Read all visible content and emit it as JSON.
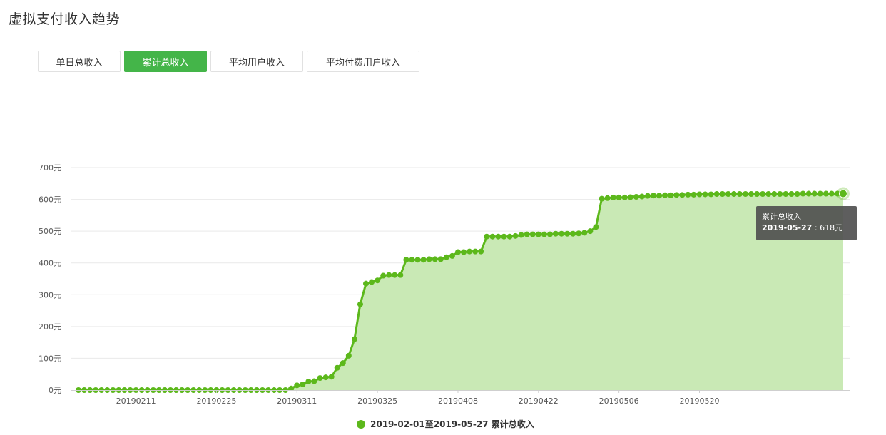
{
  "page": {
    "title": "虚拟支付收入趋势"
  },
  "tabs": [
    {
      "label": "单日总收入",
      "active": false
    },
    {
      "label": "累计总收入",
      "active": true
    },
    {
      "label": "平均用户收入",
      "active": false
    },
    {
      "label": "平均付费用户收入",
      "active": false
    }
  ],
  "tooltip": {
    "series": "累计总收入",
    "date": "2019-05-27",
    "value": "618元"
  },
  "legend": {
    "label": "2019-02-01至2019-05-27 累计总收入"
  },
  "colors": {
    "accent": "#44b549",
    "line": "#5cb81b",
    "area": "#c9e9b5"
  },
  "chart_data": {
    "type": "area",
    "ylim": [
      0,
      700
    ],
    "yticks": [
      "0元",
      "100元",
      "200元",
      "300元",
      "400元",
      "500元",
      "600元",
      "700元"
    ],
    "xticks": [
      "20190211",
      "20190225",
      "20190311",
      "20190325",
      "20190408",
      "20190422",
      "20190506",
      "20190520"
    ],
    "x_start": "2019-02-01",
    "x_end": "2019-05-27",
    "grid": true,
    "legend_position": "bottom",
    "series": [
      {
        "name": "累计总收入",
        "values": [
          0,
          0,
          0,
          0,
          0,
          0,
          0,
          0,
          0,
          0,
          0,
          0,
          0,
          0,
          0,
          0,
          0,
          0,
          0,
          0,
          0,
          0,
          0,
          0,
          0,
          0,
          0,
          0,
          0,
          0,
          0,
          0,
          0,
          0,
          0,
          0,
          0,
          5,
          15,
          18,
          27,
          28,
          38,
          40,
          42,
          70,
          85,
          108,
          160,
          270,
          335,
          340,
          345,
          360,
          362,
          362,
          362,
          410,
          410,
          410,
          410,
          412,
          412,
          412,
          418,
          422,
          434,
          434,
          436,
          436,
          436,
          483,
          483,
          483,
          483,
          483,
          485,
          488,
          490,
          490,
          490,
          490,
          490,
          492,
          492,
          492,
          492,
          493,
          495,
          500,
          513,
          602,
          604,
          606,
          606,
          606,
          607,
          608,
          609,
          611,
          612,
          612,
          613,
          613,
          614,
          614,
          615,
          615,
          616,
          616,
          616,
          617,
          617,
          617,
          617,
          617,
          617,
          617,
          617,
          617,
          617,
          617,
          617,
          617,
          617,
          617,
          618,
          618,
          618,
          618,
          618,
          618,
          618,
          618
        ]
      }
    ]
  }
}
